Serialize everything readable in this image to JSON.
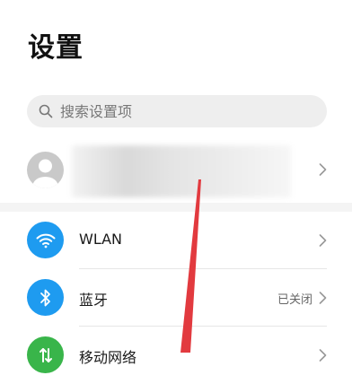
{
  "page": {
    "title": "设置"
  },
  "search": {
    "placeholder": "搜索设置项"
  },
  "account": {
    "avatar": "avatar-icon"
  },
  "items": [
    {
      "label": "WLAN",
      "value": "",
      "icon": "wifi-icon",
      "color": "#1e9bf0"
    },
    {
      "label": "蓝牙",
      "value": "已关闭",
      "icon": "bluetooth-icon",
      "color": "#1e9bf0"
    },
    {
      "label": "移动网络",
      "value": "",
      "icon": "mobile-network-icon",
      "color": "#39b54a"
    }
  ],
  "annotation": {
    "color": "#e23a3f"
  }
}
